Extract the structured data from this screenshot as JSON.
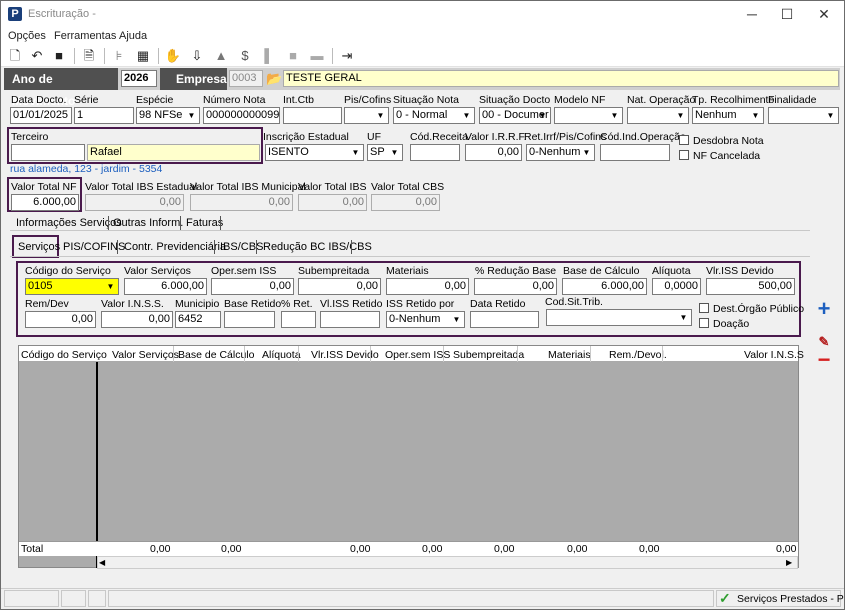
{
  "window": {
    "title": "Escrituração -",
    "app_icon": "P",
    "minimize": "─",
    "maximize": "☐",
    "close": "✕"
  },
  "menu": [
    "Opções",
    "Ferramentas",
    "Ajuda"
  ],
  "toolbar_icons": [
    "new-icon",
    "undo-icon",
    "save-icon",
    "print-preview-icon",
    "tree-icon",
    "calculator-icon",
    "hand-icon",
    "export-icon",
    "bell-icon",
    "money-icon",
    "split-icon",
    "block-icon",
    "dash-icon",
    "exit-icon"
  ],
  "header": {
    "ano_label": "Ano de Movimento",
    "ano_value": "2026",
    "empresa_label": "Empresa",
    "empresa_code": "0003",
    "empresa_name": "TESTE GERAL"
  },
  "fields": {
    "data_docto": {
      "label": "Data Docto.",
      "value": "01/01/2025"
    },
    "serie": {
      "label": "Série",
      "value": "1"
    },
    "especie": {
      "label": "Espécie",
      "value": "98 NFSe"
    },
    "numero_nota": {
      "label": "Número Nota",
      "value": "000000000099"
    },
    "int_ctb": {
      "label": "Int.Ctb",
      "value": ""
    },
    "pis_cofins": {
      "label": "Pis/Cofins",
      "value": ""
    },
    "situacao_nota": {
      "label": "Situação Nota",
      "value": "0 - Normal"
    },
    "situacao_docto": {
      "label": "Situação Docto",
      "value": "00 - Documer"
    },
    "modelo_nf": {
      "label": "Modelo NF",
      "value": ""
    },
    "nat_operacao": {
      "label": "Nat. Operação",
      "value": ""
    },
    "tp_recolhimento": {
      "label": "Tp. Recolhimento",
      "value": "Nenhum"
    },
    "finalidade": {
      "label": "Finalidade",
      "value": ""
    },
    "terceiro": {
      "label": "Terceiro",
      "code": "",
      "name": "Rafael"
    },
    "inscricao_estadual": {
      "label": "Inscrição Estadual",
      "value": "ISENTO"
    },
    "uf": {
      "label": "UF",
      "value": "SP"
    },
    "cod_receita": {
      "label": "Cód.Receita",
      "value": ""
    },
    "valor_irrf": {
      "label": "Valor I.R.R.F.",
      "value": "0,00"
    },
    "ret_irrf": {
      "label": "Ret.Irrf/Pis/Cofins",
      "value": "0-Nenhum"
    },
    "cod_ind_operacao": {
      "label": "Cód.Ind.Operação",
      "value": ""
    },
    "desdobra_nota": "Desdobra Nota",
    "nf_cancelada": "NF Cancelada",
    "address": "rua alameda, 123 - jardim - 5354",
    "valor_total_nf": {
      "label": "Valor Total NF",
      "value": "6.000,00"
    },
    "valor_total_ibs_estadual": {
      "label": "Valor Total IBS Estadual",
      "value": "0,00"
    },
    "valor_total_ibs_municipal": {
      "label": "Valor Total IBS Municipal",
      "value": "0,00"
    },
    "valor_total_ibs": {
      "label": "Valor Total IBS",
      "value": "0,00"
    },
    "valor_total_cbs": {
      "label": "Valor Total CBS",
      "value": "0,00"
    }
  },
  "tabs1": [
    "Informações Serviços",
    "Outras Inform.",
    "Faturas"
  ],
  "tabs2": [
    "Serviços",
    "PIS/COFINS",
    "Contr. Previdenciária",
    "IBS/CBS",
    "Redução BC IBS/CBS"
  ],
  "servicos": {
    "codigo_servico": {
      "label": "Código do Serviço",
      "value": "0105"
    },
    "valor_servicos": {
      "label": "Valor Serviços",
      "value": "6.000,00"
    },
    "oper_sem_iss": {
      "label": "Oper.sem ISS",
      "value": "0,00"
    },
    "subempreitada": {
      "label": "Subempreitada",
      "value": "0,00"
    },
    "materiais": {
      "label": "Materiais",
      "value": "0,00"
    },
    "perc_reducao_base": {
      "label": "% Redução Base",
      "value": "0,00"
    },
    "base_calculo": {
      "label": "Base de Cálculo",
      "value": "6.000,00"
    },
    "aliquota": {
      "label": "Alíquota",
      "value": "0,0000"
    },
    "vlr_iss_devido": {
      "label": "Vlr.ISS Devido",
      "value": "500,00"
    },
    "rem_dev": {
      "label": "Rem/Dev",
      "value": "0,00"
    },
    "valor_inss": {
      "label": "Valor I.N.S.S.",
      "value": "0,00"
    },
    "municipio": {
      "label": "Municipio",
      "value": "6452"
    },
    "base_retido": {
      "label": "Base Retido",
      "value": ""
    },
    "perc_ret": {
      "label": "% Ret.",
      "value": ""
    },
    "vl_iss_retido": {
      "label": "Vl.ISS Retido",
      "value": ""
    },
    "iss_retido_por": {
      "label": "ISS Retido por",
      "value": "0-Nenhum"
    },
    "data_retido": {
      "label": "Data Retido",
      "value": ""
    },
    "cod_sit_trib": {
      "label": "Cod.Sit.Trib.",
      "value": ""
    },
    "dest_orgao_publico": "Dest.Órgão Público",
    "doacao": "Doação"
  },
  "grid": {
    "columns": [
      "Código do Serviço",
      "Valor Serviços",
      "Base de Cálculo",
      "Alíquota",
      "Vlr.ISS Devido",
      "Oper.sem ISS",
      "Subempreitada",
      "Materiais",
      "Rem./Devol.",
      "Valor I.N.S.S"
    ],
    "total_label": "Total",
    "totals": [
      "0,00",
      "0,00",
      "0,00",
      "0,00",
      "0,00",
      "0,00",
      "0,00",
      "0,00"
    ]
  },
  "status": {
    "text": "Serviços Prestados - P"
  },
  "colors": {
    "highlight_border": "#4a1a4d",
    "header_dark": "#505050",
    "yellow": "#ffff00",
    "plus": "#1d5fbf",
    "minus": "#d62020"
  }
}
